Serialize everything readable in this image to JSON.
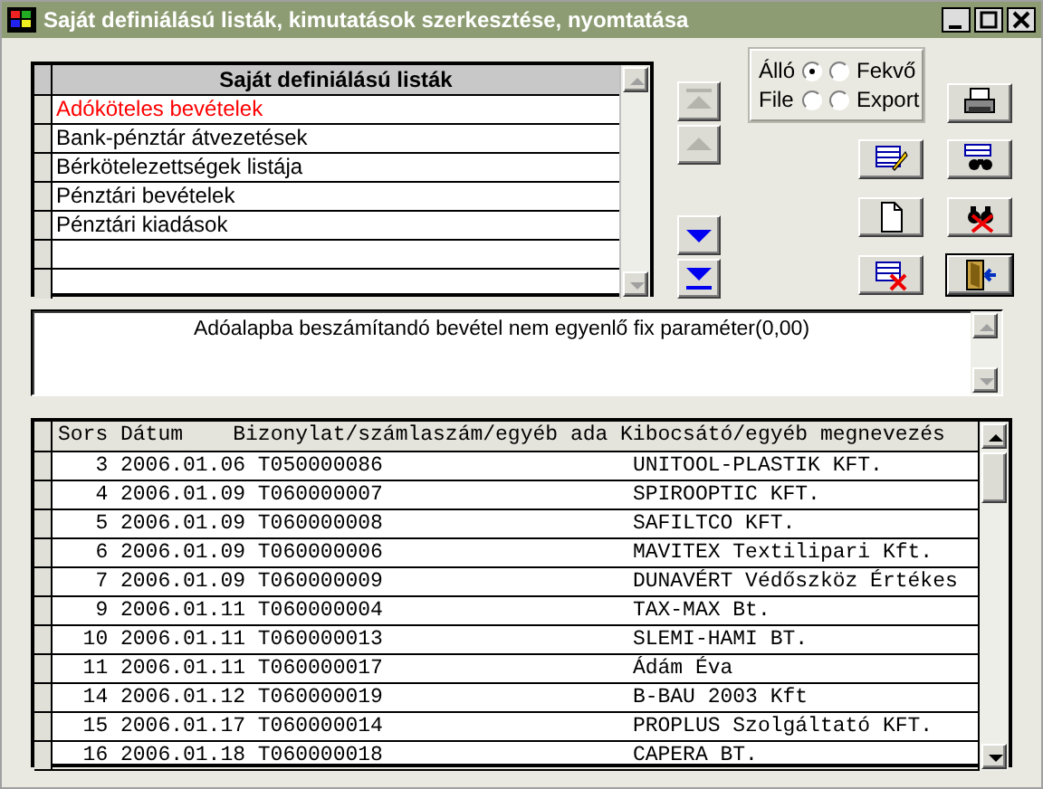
{
  "window": {
    "title": "Saját definiálású listák, kimutatások szerkesztése, nyomtatása"
  },
  "lists": {
    "header": "Saját definiálású listák",
    "items": [
      {
        "label": "Adóköteles bevételek",
        "selected": true
      },
      {
        "label": "Bank-pénztár átvezetések",
        "selected": false
      },
      {
        "label": "Bérkötelezettségek listája",
        "selected": false
      },
      {
        "label": "Pénztári bevételek",
        "selected": false
      },
      {
        "label": "Pénztári kiadások",
        "selected": false
      }
    ]
  },
  "nav_buttons": [
    {
      "kind": "first",
      "disabled": true
    },
    {
      "kind": "up",
      "disabled": true
    },
    {
      "kind": "down",
      "disabled": false
    },
    {
      "kind": "last",
      "disabled": false
    }
  ],
  "print_options": {
    "orientation": [
      {
        "label": "Álló",
        "selected": true
      },
      {
        "label": "Fekvő",
        "selected": false
      }
    ],
    "output": [
      {
        "label": "File",
        "selected": false
      },
      {
        "label": "Export",
        "selected": false
      }
    ]
  },
  "tool_buttons": [
    {
      "kind": "print",
      "default": false
    },
    {
      "kind": "edit",
      "default": false
    },
    {
      "kind": "find",
      "default": false
    },
    {
      "kind": "new",
      "default": false
    },
    {
      "kind": "find-clear",
      "default": false
    },
    {
      "kind": "delete",
      "default": false
    },
    {
      "kind": "exit",
      "default": true
    }
  ],
  "message": "Adóalapba beszámítandó bevétel nem egyenlő fix paraméter(0,00)",
  "table": {
    "columns": [
      "Sors",
      "Dátum",
      "Bizonylat/számlaszám/egyéb ada",
      "Kibocsátó/egyéb megnevezés"
    ],
    "rows": [
      [
        "3",
        "2006.01.06",
        "T050000086",
        "UNITOOL-PLASTIK KFT."
      ],
      [
        "4",
        "2006.01.09",
        "T060000007",
        "SPIROOPTIC KFT."
      ],
      [
        "5",
        "2006.01.09",
        "T060000008",
        "SAFILTCO KFT."
      ],
      [
        "6",
        "2006.01.09",
        "T060000006",
        "MAVITEX Textilipari Kft."
      ],
      [
        "7",
        "2006.01.09",
        "T060000009",
        "DUNAVÉRT Védőszköz Értékes"
      ],
      [
        "9",
        "2006.01.11",
        "T060000004",
        "TAX-MAX Bt."
      ],
      [
        "10",
        "2006.01.11",
        "T060000013",
        "SLEMI-HAMI BT."
      ],
      [
        "11",
        "2006.01.11",
        "T060000017",
        "Ádám Éva"
      ],
      [
        "14",
        "2006.01.12",
        "T060000019",
        "B-BAU 2003 Kft"
      ],
      [
        "15",
        "2006.01.17",
        "T060000014",
        "PROPLUS Szolgáltató KFT."
      ],
      [
        "16",
        "2006.01.18",
        "T060000018",
        "CAPERA BT."
      ]
    ]
  }
}
